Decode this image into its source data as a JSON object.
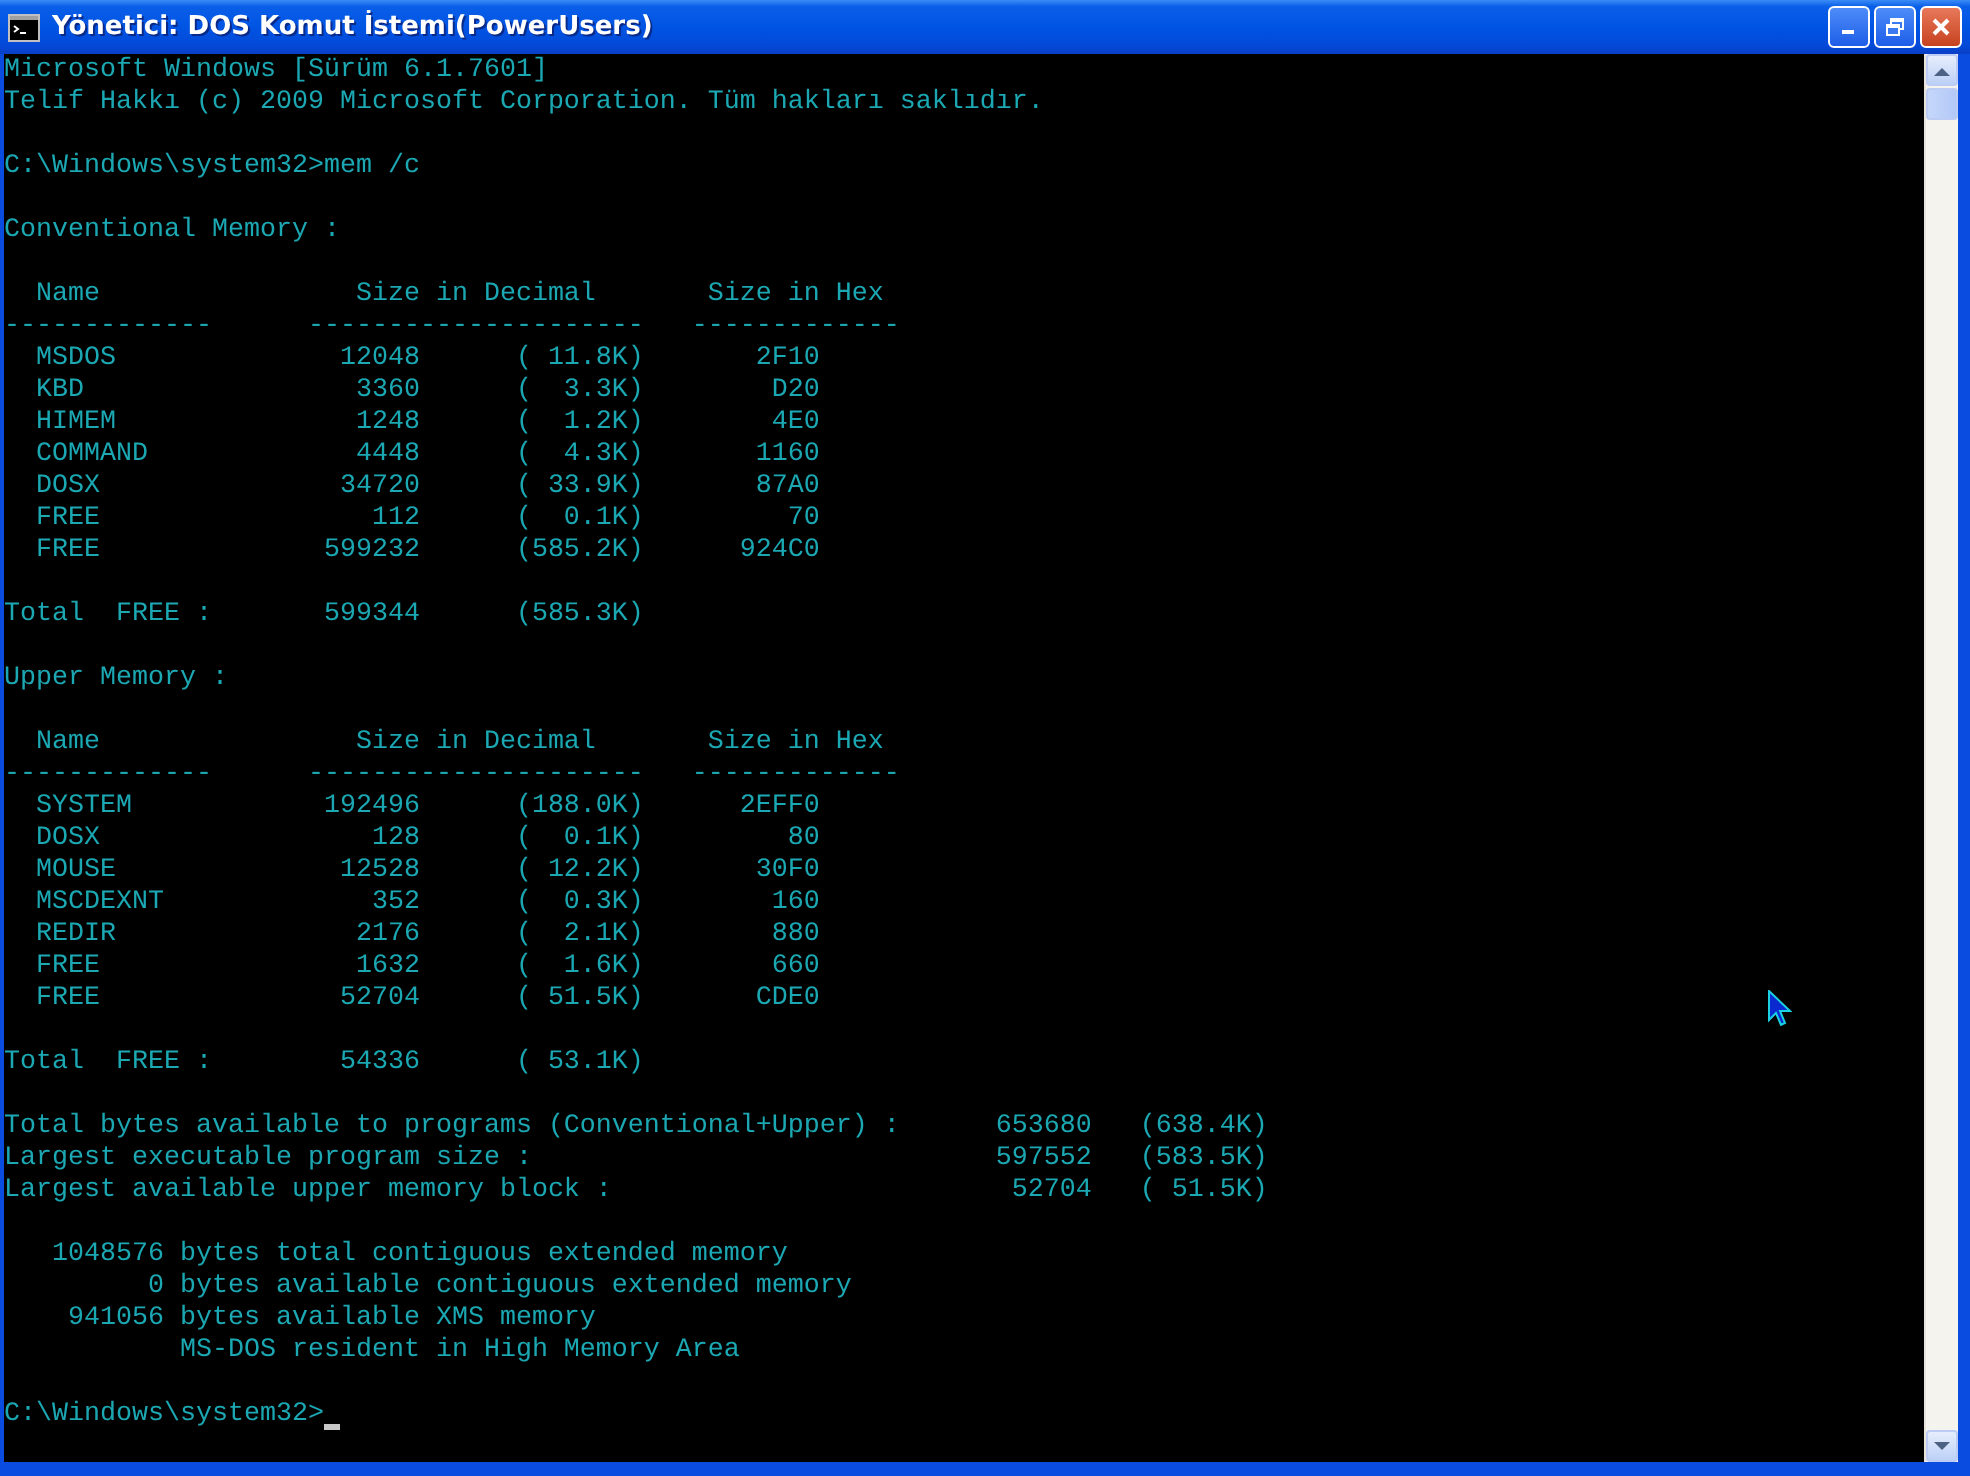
{
  "window": {
    "title": "Yönetici: DOS Komut İstemi(PowerUsers)"
  },
  "console": {
    "blocks": [
      [
        "Microsoft Windows [Sürüm 6.1.7601]",
        "Telif Hakkı (c) 2009 Microsoft Corporation. Tüm hakları saklıdır."
      ],
      [
        "C:\\Windows\\system32>mem /c"
      ],
      [
        "Conventional Memory :"
      ],
      [
        "  Name                Size in Decimal       Size in Hex",
        "-------------      ---------------------   -------------",
        "  MSDOS              12048      ( 11.8K)       2F10",
        "  KBD                 3360      (  3.3K)        D20",
        "  HIMEM               1248      (  1.2K)        4E0",
        "  COMMAND             4448      (  4.3K)       1160",
        "  DOSX               34720      ( 33.9K)       87A0",
        "  FREE                 112      (  0.1K)         70",
        "  FREE              599232      (585.2K)      924C0"
      ],
      [
        "Total  FREE :       599344      (585.3K)"
      ],
      [
        "Upper Memory :"
      ],
      [
        "  Name                Size in Decimal       Size in Hex",
        "-------------      ---------------------   -------------",
        "  SYSTEM            192496      (188.0K)      2EFF0",
        "  DOSX                 128      (  0.1K)         80",
        "  MOUSE              12528      ( 12.2K)       30F0",
        "  MSCDEXNT             352      (  0.3K)        160",
        "  REDIR               2176      (  2.1K)        880",
        "  FREE                1632      (  1.6K)        660",
        "  FREE               52704      ( 51.5K)       CDE0"
      ],
      [
        "Total  FREE :        54336      ( 53.1K)"
      ],
      [
        "Total bytes available to programs (Conventional+Upper) :      653680   (638.4K)",
        "Largest executable program size :                             597552   (583.5K)",
        "Largest available upper memory block :                         52704   ( 51.5K)"
      ],
      [
        "   1048576 bytes total contiguous extended memory",
        "         0 bytes available contiguous extended memory",
        "    941056 bytes available XMS memory",
        "           MS-DOS resident in High Memory Area"
      ],
      [
        "C:\\Windows\\system32>"
      ]
    ]
  }
}
